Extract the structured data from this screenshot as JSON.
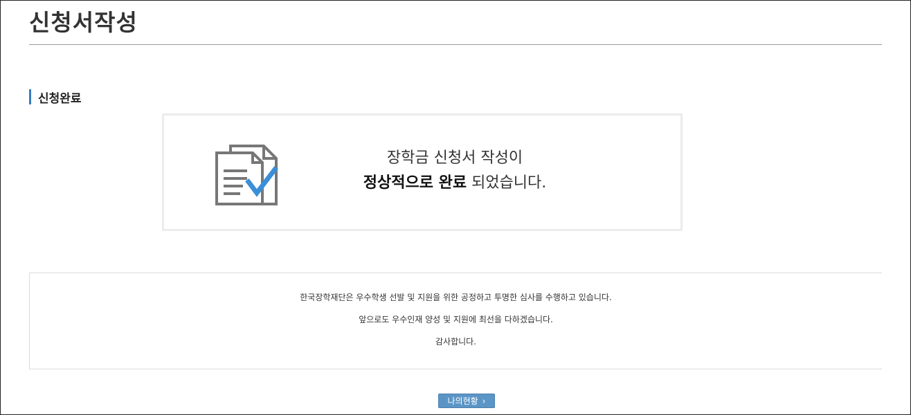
{
  "header": {
    "title": "신청서작성"
  },
  "section": {
    "heading": "신청완료"
  },
  "completion": {
    "icon": "document-check-icon",
    "line1": "장학금 신청서 작성이",
    "line2_bold": "정상적으로 완료",
    "line2_rest": " 되었습니다."
  },
  "notice": {
    "line1": "한국장학재단은 우수학생 선발 및 지원을 위한 공정하고 투명한 심사를 수행하고 있습니다.",
    "line2": "앞으로도 우수인재 양성 및 지원에 최선을 다하겠습니다.",
    "line3": "감사합니다."
  },
  "actions": {
    "my_status_label": "나의현황",
    "my_status_icon": "chevron-right-icon"
  },
  "colors": {
    "accent": "#3b7bbf",
    "button": "#5b95c6",
    "icon_gray": "#777777",
    "check_blue": "#3a8fd8"
  }
}
